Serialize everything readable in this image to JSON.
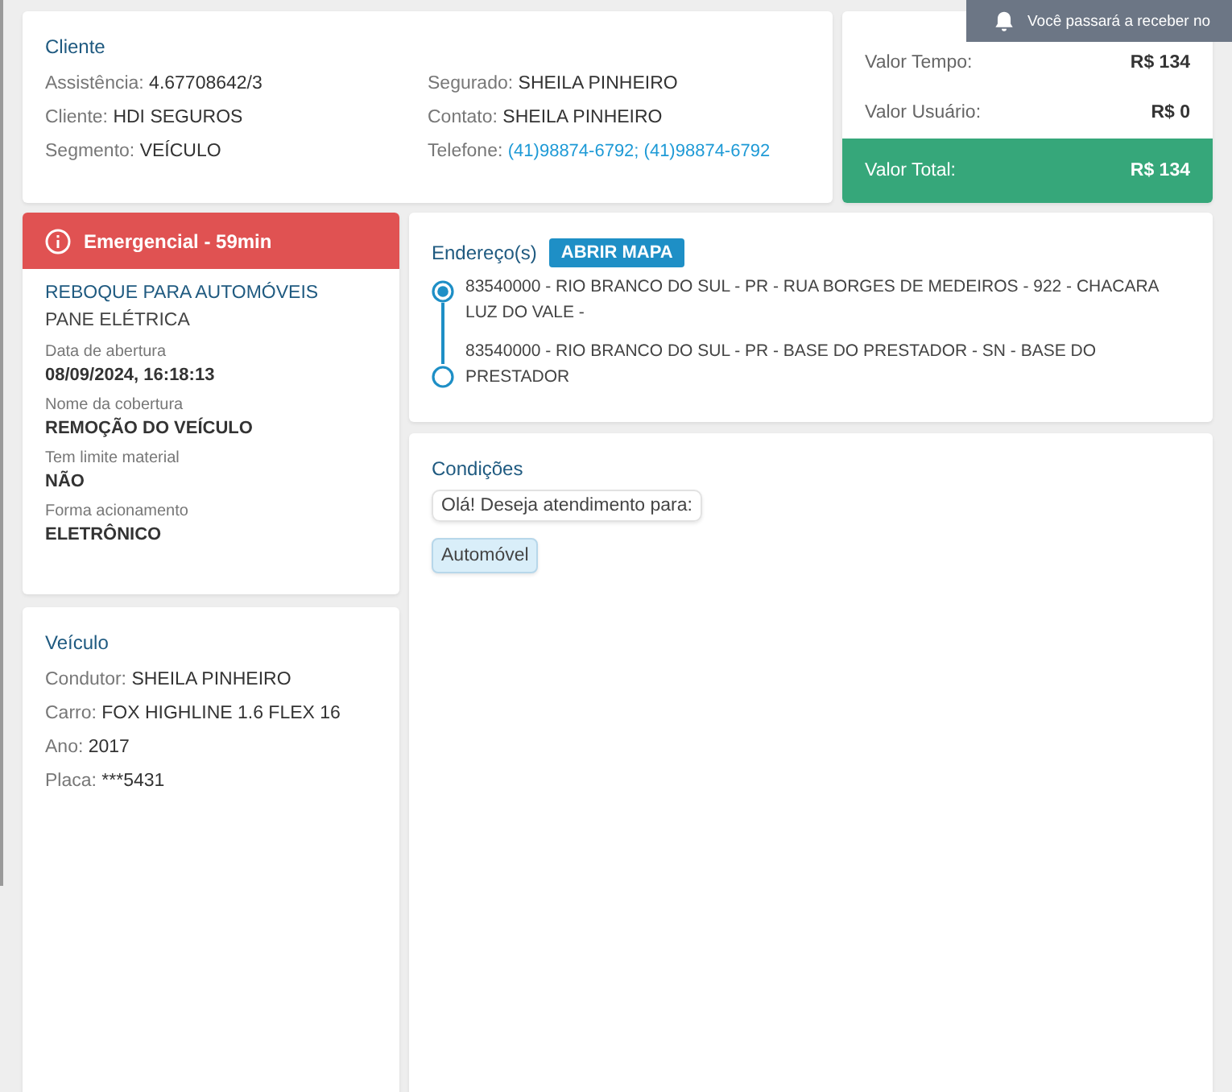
{
  "cliente": {
    "title": "Cliente",
    "left": [
      {
        "label": "Assistência:",
        "value": "4.67708642/3"
      },
      {
        "label": "Cliente:",
        "value": "HDI SEGUROS"
      },
      {
        "label": "Segmento:",
        "value": "VEÍCULO"
      }
    ],
    "right": [
      {
        "label": "Segurado:",
        "value": "SHEILA PINHEIRO",
        "kind": "text"
      },
      {
        "label": "Contato:",
        "value": "SHEILA PINHEIRO",
        "kind": "text"
      },
      {
        "label": "Telefone:",
        "value": "(41)98874-6792; (41)98874-6792",
        "kind": "link"
      }
    ]
  },
  "valores": [
    {
      "label": "Valor Tempo:",
      "value": "R$ 134",
      "kind": "normal"
    },
    {
      "label": "Valor Usuário:",
      "value": "R$ 0",
      "kind": "normal"
    },
    {
      "label": "Valor Total:",
      "value": "R$ 134",
      "kind": "total"
    }
  ],
  "toast": {
    "text": "Você passará a receber no"
  },
  "servico": {
    "badge": "Emergencial - 59min",
    "title": "REBOQUE PARA AUTOMÓVEIS",
    "subtitle": "PANE ELÉTRICA",
    "fields": [
      {
        "label": "Data de abertura",
        "value": "08/09/2024, 16:18:13"
      },
      {
        "label": "Nome da cobertura",
        "value": "REMOÇÃO DO VEÍCULO"
      },
      {
        "label": "Tem limite material",
        "value": "NÃO"
      },
      {
        "label": "Forma acionamento",
        "value": "ELETRÔNICO"
      }
    ]
  },
  "veiculo": {
    "title": "Veículo",
    "rows": [
      {
        "label": "Condutor:",
        "value": "SHEILA PINHEIRO"
      },
      {
        "label": "Carro:",
        "value": "FOX HIGHLINE 1.6 FLEX 16"
      },
      {
        "label": "Ano:",
        "value": "2017"
      },
      {
        "label": "Placa:",
        "value": "***5431"
      }
    ]
  },
  "enderecos": {
    "title": "Endereço(s)",
    "button": "ABRIR MAPA",
    "items": [
      {
        "text": "83540000 - RIO BRANCO DO SUL - PR - RUA BORGES DE MEDEIROS - 922 - CHACARA LUZ DO VALE -",
        "kind": "origin"
      },
      {
        "text": "83540000 - RIO BRANCO DO SUL - PR - BASE DO PRESTADOR - SN - BASE DO PRESTADOR",
        "kind": "destination"
      }
    ]
  },
  "condicoes": {
    "title": "Condições",
    "items": [
      {
        "text": "Olá! Deseja atendimento para:",
        "kind": "message"
      },
      {
        "text": "Automóvel",
        "kind": "option"
      }
    ]
  }
}
